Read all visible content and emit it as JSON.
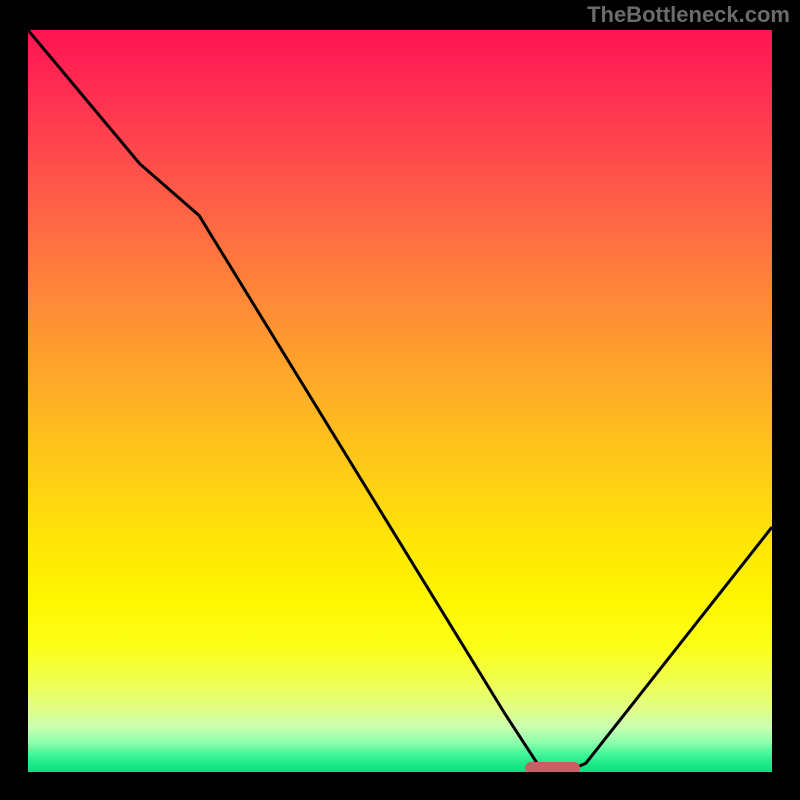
{
  "watermark": "TheBottleneck.com",
  "chart_data": {
    "type": "line",
    "title": "",
    "xlabel": "",
    "ylabel": "",
    "x_range_pct": [
      0,
      100
    ],
    "y_range_pct": [
      0,
      100
    ],
    "series": [
      {
        "name": "curve",
        "x_pct": [
          0,
          15,
          23,
          64,
          69,
          73,
          75,
          100
        ],
        "y_pct": [
          100,
          82,
          75,
          8,
          0.3,
          0.3,
          1.2,
          33
        ]
      }
    ],
    "marker": {
      "name": "highlight-pill",
      "x_center_pct": 70.5,
      "width_pct": 7.5,
      "y_pct": 0.6,
      "color": "#c76062"
    },
    "gradient_stops": [
      {
        "pct": 0,
        "color": "#ff1552"
      },
      {
        "pct": 62,
        "color": "#ffd312"
      },
      {
        "pct": 100,
        "color": "#0ce082"
      }
    ],
    "frame": {
      "border_color": "#000000",
      "bg": "#000000"
    }
  }
}
